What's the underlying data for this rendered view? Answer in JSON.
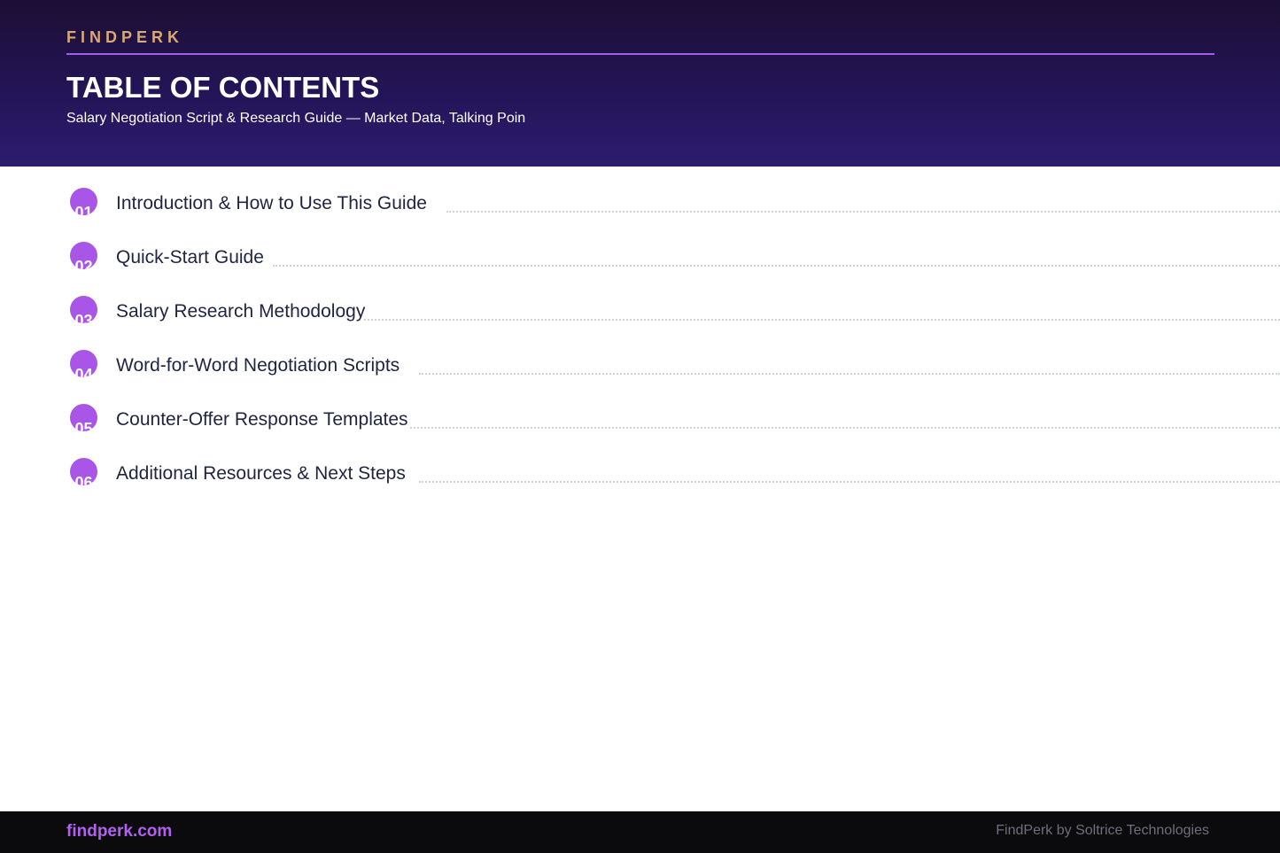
{
  "header": {
    "brand": "FINDPERK",
    "title": "TABLE OF CONTENTS",
    "subtitle": "Salary Negotiation Script & Research Guide — Market Data, Talking Poin"
  },
  "toc": {
    "items": [
      {
        "number": "01",
        "label": "Introduction & How to Use This Guide"
      },
      {
        "number": "02",
        "label": "Quick-Start Guide"
      },
      {
        "number": "03",
        "label": "Salary Research Methodology"
      },
      {
        "number": "04",
        "label": "Word-for-Word Negotiation Scripts"
      },
      {
        "number": "05",
        "label": "Counter-Offer Response Templates"
      },
      {
        "number": "06",
        "label": "Additional Resources & Next Steps"
      }
    ]
  },
  "footer": {
    "url": "findperk.com",
    "credit": "FindPerk by Soltrice Technologies"
  },
  "colors": {
    "accent": "#a855e8",
    "brand_gold": "#d9a877",
    "header_bg": "#24155a",
    "footer_bg": "#0b0b0d"
  }
}
